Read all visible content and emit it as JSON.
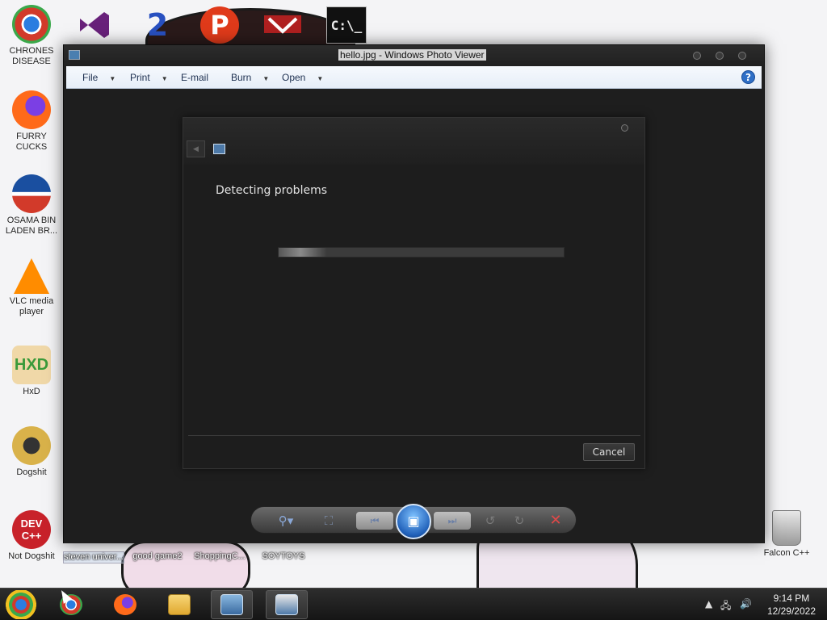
{
  "desktop": {
    "left_icons": [
      {
        "name": "chrome-icon",
        "label": "CHRONES DISEASE",
        "color": "#2a7de0"
      },
      {
        "name": "firefox-icon",
        "label": "FURRY CUCKS",
        "color": "#ff6a1a"
      },
      {
        "name": "obama-logo-icon",
        "label": "OSAMA BIN LADEN BR...",
        "color": "#1a4fa0"
      },
      {
        "name": "vlc-icon",
        "label": "VLC media player",
        "color": "#ff8c00"
      },
      {
        "name": "hxd-icon",
        "label": "HxD",
        "color": "#3a9a3a"
      },
      {
        "name": "dev-cpp-icon",
        "label": "Dogshit",
        "color": "#d9b24a"
      },
      {
        "name": "dev-cpp-red-icon",
        "label": "Not Dogshit",
        "color": "#c8222a"
      }
    ],
    "top_icons": [
      "visual-studio-icon",
      "speedrun-2-icon",
      "p-icon",
      "papers-please-icon",
      "command-prompt-icon"
    ],
    "below_labels": [
      "steven univer...",
      "good game2",
      "ShoppingC...",
      "SOYTOYS"
    ],
    "right_icons": [
      {
        "name": "recycle-bin-icon",
        "label": "Falcon C++"
      }
    ],
    "top_icon_text": {
      "cmd": "C:\\_",
      "p": "P",
      "two": "2"
    }
  },
  "window": {
    "title": "hello.jpg - Windows Photo Viewer",
    "menu": [
      {
        "label": "File",
        "has_dropdown": true
      },
      {
        "label": "Print",
        "has_dropdown": true
      },
      {
        "label": "E-mail",
        "has_dropdown": false
      },
      {
        "label": "Burn",
        "has_dropdown": true
      },
      {
        "label": "Open",
        "has_dropdown": true
      }
    ],
    "help_label": "?"
  },
  "dialog": {
    "heading": "Detecting problems",
    "progress": 0.17,
    "cancel_label": "Cancel"
  },
  "viewer_toolbar": {
    "tools": [
      "zoom-icon",
      "actual-size-icon",
      "previous-icon",
      "slideshow-icon",
      "next-icon",
      "rotate-counterclockwise-icon",
      "rotate-clockwise-icon",
      "delete-icon"
    ],
    "delete_color": "#e04848"
  },
  "taskbar": {
    "items": [
      "chrome-icon",
      "firefox-icon",
      "file-explorer-icon",
      "photo-viewer-icon",
      "troubleshooter-icon"
    ],
    "time": "9:14 PM",
    "date": "12/29/2022"
  }
}
